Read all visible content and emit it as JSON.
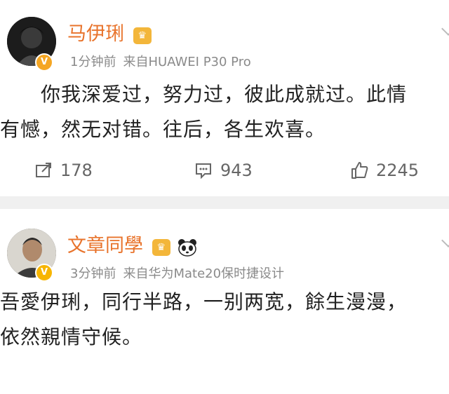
{
  "posts": [
    {
      "user": {
        "name": "马伊琍",
        "verified_badge": "V"
      },
      "meta": {
        "time": "1分钟前",
        "source": "来自HUAWEI P30 Pro"
      },
      "text": {
        "line1": "你我深爱过，努力过，彼此成就过。此情",
        "line2": "有憾，然无对错。往后，各生欢喜。"
      },
      "actions": {
        "repost": "178",
        "comment": "943",
        "like": "2245"
      }
    },
    {
      "user": {
        "name": "文章同學",
        "verified_badge": "V"
      },
      "meta": {
        "time": "3分钟前",
        "source": "来自华为Mate20保时捷设计"
      },
      "text": {
        "line1": "吾愛伊琍，同行半路，一别两宽，餘生漫漫，",
        "line2": "依然親情守候。"
      }
    }
  ],
  "icons": {
    "repost": "repost-icon",
    "comment": "comment-icon",
    "like": "like-icon",
    "crown": "crown-badge-icon",
    "panda": "panda-icon",
    "more": "chevron-down-icon"
  },
  "colors": {
    "name": "#e8732b",
    "meta": "#8a8a8a",
    "text": "#222222",
    "divider": "#f0f0f0",
    "badge": "#f5a623"
  }
}
